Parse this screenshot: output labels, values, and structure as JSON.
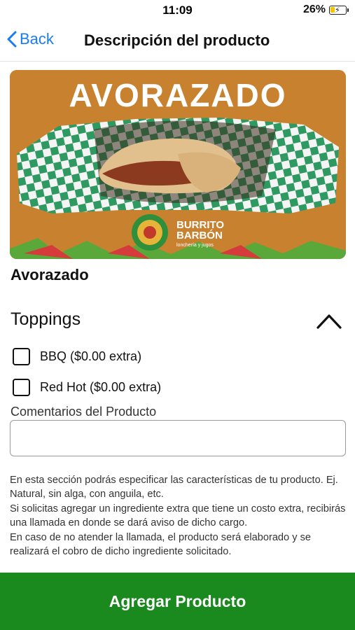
{
  "status_bar": {
    "time": "11:09",
    "battery_percent": "26%"
  },
  "nav": {
    "back_label": "Back",
    "title": "Descripción del producto"
  },
  "hero": {
    "headline": "AVORAZADO",
    "brand_line1": "BURRITO",
    "brand_line2": "BARBÓN",
    "brand_tagline": "lonchería y jugos",
    "colors": {
      "background": "#c8812f",
      "checker_green": "#2e9a62"
    }
  },
  "product": {
    "name": "Avorazado"
  },
  "toppings": {
    "title": "Toppings",
    "options": [
      {
        "label": "BBQ ($0.00 extra)",
        "checked": false
      },
      {
        "label": "Red Hot ($0.00 extra)",
        "checked": false
      }
    ]
  },
  "comments": {
    "label": "Comentarios del Producto",
    "value": "",
    "placeholder": ""
  },
  "help": [
    "En esta sección podrás especificar las características de tu producto. Ej. Natural, sin alga, con anguila, etc.",
    "Si solicitas agregar un ingrediente extra que tiene un costo extra, recibirás una llamada en donde se dará aviso de dicho cargo.",
    "En caso de no atender la llamada, el producto será elaborado y se realizará el cobro de dicho ingrediente solicitado."
  ],
  "cta": {
    "label": "Agregar Producto",
    "color": "#1a8a1e"
  }
}
